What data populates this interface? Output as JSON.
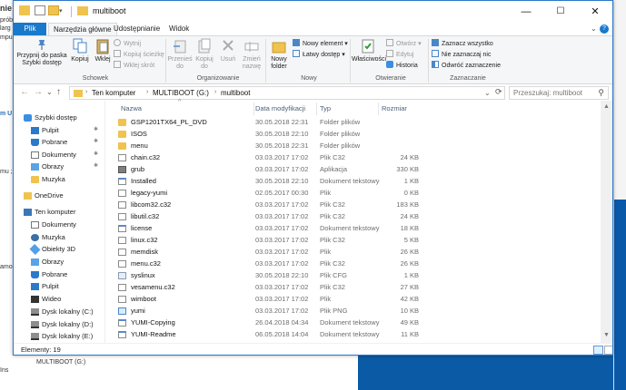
{
  "background": {
    "left_fragments": [
      "nie",
      "larg",
      "mpu",
      "próbe",
      "m U",
      "mu ;",
      "amo",
      "Ins"
    ],
    "bottom_fragment": "MULTIBOOT (G:)"
  },
  "window": {
    "title": "multiboot",
    "controls": {
      "minimize": "—",
      "maximize": "☐",
      "close": "✕"
    }
  },
  "quick_access": {
    "dropdown_glyph": "▾"
  },
  "ribbon_tabs": {
    "file": "Plik",
    "home": "Narzędzia główne",
    "share": "Udostępnianie",
    "view": "Widok",
    "expand_glyph": "⌄",
    "help_glyph": "?"
  },
  "ribbon": {
    "groups": {
      "clipboard": "Schowek",
      "organize": "Organizowanie",
      "new": "Nowy",
      "open": "Otwieranie",
      "select": "Zaznaczanie"
    },
    "pin_label": "Przypnij do paska Szybki dostęp",
    "copy_label": "Kopiuj",
    "paste_label": "Wklej",
    "cut_label": "Wytnij",
    "copy_path_label": "Kopiuj ścieżkę",
    "paste_shortcut_label": "Wklej skrót",
    "move_to_label": "Przenieś do",
    "copy_to_label": "Kopiuj do",
    "delete_label": "Usuń",
    "rename_label": "Zmień nazwę",
    "new_folder_label": "Nowy folder",
    "new_item_label": "Nowy element ▾",
    "easy_access_label": "Łatwy dostęp ▾",
    "properties_label": "Właściwości",
    "open_label": "Otwórz ▾",
    "edit_label": "Edytuj",
    "history_label": "Historia",
    "select_all_label": "Zaznacz wszystko",
    "select_none_label": "Nie zaznaczaj nic",
    "invert_selection_label": "Odwróć zaznaczenie"
  },
  "address": {
    "back": "←",
    "forward": "→",
    "recent": "⌄",
    "up": "↑",
    "sep": "›",
    "crumbs": [
      "Ten komputer",
      "MULTIBOOT (G:)",
      "multiboot"
    ],
    "dropdown": "⌄",
    "refresh": "⟳",
    "search_placeholder": "Przeszukaj: multiboot",
    "search_glyph": "⚲"
  },
  "nav_pane": {
    "items": [
      {
        "label": "Szybki dostęp",
        "icon": "star-icon",
        "pinned": false
      },
      {
        "label": "Pulpit",
        "icon": "desktop-icon",
        "pinned": true
      },
      {
        "label": "Pobrane",
        "icon": "download-icon",
        "pinned": true
      },
      {
        "label": "Dokumenty",
        "icon": "documents-icon",
        "pinned": true
      },
      {
        "label": "Obrazy",
        "icon": "pictures-icon",
        "pinned": true
      },
      {
        "label": "Muzyka",
        "icon": "folder-icon",
        "pinned": false
      },
      {
        "label": "OneDrive",
        "icon": "onedrive-icon",
        "pinned": false
      },
      {
        "label": "Ten komputer",
        "icon": "computer-icon",
        "pinned": false
      },
      {
        "label": "Dokumenty",
        "icon": "documents-icon",
        "pinned": false
      },
      {
        "label": "Muzyka",
        "icon": "music-icon",
        "pinned": false
      },
      {
        "label": "Obiekty 3D",
        "icon": "3d-objects-icon",
        "pinned": false
      },
      {
        "label": "Obrazy",
        "icon": "pictures-icon",
        "pinned": false
      },
      {
        "label": "Pobrane",
        "icon": "download-icon",
        "pinned": false
      },
      {
        "label": "Pulpit",
        "icon": "desktop-icon",
        "pinned": false
      },
      {
        "label": "Wideo",
        "icon": "video-icon",
        "pinned": false
      },
      {
        "label": "Dysk lokalny (C:)",
        "icon": "drive-icon",
        "pinned": false
      },
      {
        "label": "Dysk lokalny (D:)",
        "icon": "drive-icon",
        "pinned": false
      },
      {
        "label": "Dysk lokalny (E:)",
        "icon": "drive-icon",
        "pinned": false
      },
      {
        "label": "MULTIBOOT (G:)",
        "icon": "drive-icon",
        "pinned": false,
        "selected": true
      }
    ],
    "pin_glyph": "✱"
  },
  "columns": {
    "name": "Nazwa",
    "date": "Data modyfikacji",
    "type": "Typ",
    "size": "Rozmiar",
    "sort_glyph": "^"
  },
  "files": [
    {
      "name": "GSP1201TX64_PL_DVD",
      "date": "30.05.2018 22:31",
      "type": "Folder plików",
      "size": "",
      "icon": "folder"
    },
    {
      "name": "ISOS",
      "date": "30.05.2018 22:10",
      "type": "Folder plików",
      "size": "",
      "icon": "folder"
    },
    {
      "name": "menu",
      "date": "30.05.2018 22:31",
      "type": "Folder plików",
      "size": "",
      "icon": "folder"
    },
    {
      "name": "chain.c32",
      "date": "03.03.2017 17:02",
      "type": "Plik C32",
      "size": "24 KB",
      "icon": "file"
    },
    {
      "name": "grub",
      "date": "03.03.2017 17:02",
      "type": "Aplikacja",
      "size": "330 KB",
      "icon": "app"
    },
    {
      "name": "Installed",
      "date": "30.05.2018 22:10",
      "type": "Dokument tekstowy",
      "size": "1 KB",
      "icon": "text"
    },
    {
      "name": "legacy-yumi",
      "date": "02.05.2017 00:30",
      "type": "Plik",
      "size": "0 KB",
      "icon": "file"
    },
    {
      "name": "libcom32.c32",
      "date": "03.03.2017 17:02",
      "type": "Plik C32",
      "size": "183 KB",
      "icon": "file"
    },
    {
      "name": "libutil.c32",
      "date": "03.03.2017 17:02",
      "type": "Plik C32",
      "size": "24 KB",
      "icon": "file"
    },
    {
      "name": "license",
      "date": "03.03.2017 17:02",
      "type": "Dokument tekstowy",
      "size": "18 KB",
      "icon": "text"
    },
    {
      "name": "linux.c32",
      "date": "03.03.2017 17:02",
      "type": "Plik C32",
      "size": "5 KB",
      "icon": "file"
    },
    {
      "name": "memdisk",
      "date": "03.03.2017 17:02",
      "type": "Plik",
      "size": "26 KB",
      "icon": "file"
    },
    {
      "name": "menu.c32",
      "date": "03.03.2017 17:02",
      "type": "Plik C32",
      "size": "26 KB",
      "icon": "file"
    },
    {
      "name": "syslinux",
      "date": "30.05.2018 22:10",
      "type": "Plik CFG",
      "size": "1 KB",
      "icon": "cfg"
    },
    {
      "name": "vesamenu.c32",
      "date": "03.03.2017 17:02",
      "type": "Plik C32",
      "size": "27 KB",
      "icon": "file"
    },
    {
      "name": "wimboot",
      "date": "03.03.2017 17:02",
      "type": "Plik",
      "size": "42 KB",
      "icon": "file"
    },
    {
      "name": "yumi",
      "date": "03.03.2017 17:02",
      "type": "Plik PNG",
      "size": "10 KB",
      "icon": "png"
    },
    {
      "name": "YUMI-Copying",
      "date": "26.04.2018 04:34",
      "type": "Dokument tekstowy",
      "size": "49 KB",
      "icon": "text"
    },
    {
      "name": "YUMI-Readme",
      "date": "06.05.2018 14:04",
      "type": "Dokument tekstowy",
      "size": "11 KB",
      "icon": "text"
    }
  ],
  "scrollbar": {
    "up": "▲",
    "down": "▼"
  },
  "status": {
    "text": "Elementy: 19"
  },
  "colors": {
    "accent": "#1979ca",
    "folder": "#f0c34e",
    "selected": "#cce8ff"
  }
}
